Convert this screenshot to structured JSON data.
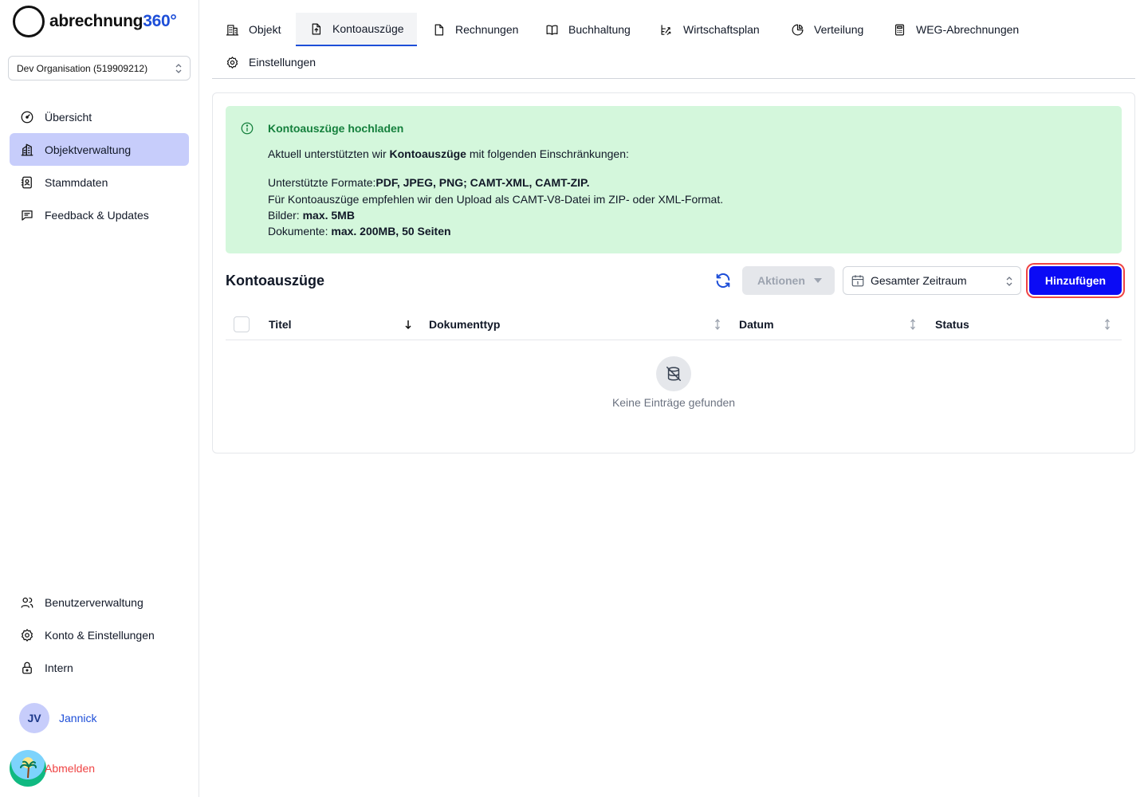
{
  "brand": {
    "name_main": "abrechnung",
    "name_accent": "360°"
  },
  "organization": {
    "selected": "Dev Organisation (519909212)"
  },
  "sidebar": {
    "top_items": [
      {
        "label": "Übersicht",
        "icon": "gauge-icon"
      },
      {
        "label": "Objektverwaltung",
        "icon": "buildings-icon",
        "active": true
      },
      {
        "label": "Stammdaten",
        "icon": "address-book-icon"
      },
      {
        "label": "Feedback & Updates",
        "icon": "chat-icon"
      }
    ],
    "bottom_items": [
      {
        "label": "Benutzerverwaltung",
        "icon": "users-icon"
      },
      {
        "label": "Konto & Einstellungen",
        "icon": "gear-icon"
      },
      {
        "label": "Intern",
        "icon": "lock-icon"
      }
    ],
    "user": {
      "initials": "JV",
      "name": "Jannick"
    },
    "logout_label": "Abmelden"
  },
  "tabs": [
    {
      "label": "Objekt",
      "icon": "building-icon"
    },
    {
      "label": "Kontoauszüge",
      "icon": "file-upload-icon",
      "active": true
    },
    {
      "label": "Rechnungen",
      "icon": "file-icon"
    },
    {
      "label": "Buchhaltung",
      "icon": "book-icon"
    },
    {
      "label": "Wirtschaftsplan",
      "icon": "chart-arrow-icon"
    },
    {
      "label": "Verteilung",
      "icon": "pie-chart-icon"
    },
    {
      "label": "WEG-Abrechnungen",
      "icon": "calculator-icon"
    },
    {
      "label": "Einstellungen",
      "icon": "gear-icon"
    }
  ],
  "alert": {
    "title": "Kontoauszüge hochladen",
    "intro_prefix": "Aktuell unterstützten wir ",
    "intro_bold": "Kontoauszüge",
    "intro_suffix": " mit folgenden Einschränkungen:",
    "formats_prefix": "Unterstützte Formate:",
    "formats_bold": "PDF, JPEG, PNG; CAMT-XML, CAMT-ZIP.",
    "recommendation": "Für Kontoauszüge empfehlen wir den Upload als CAMT-V8-Datei im ZIP- oder XML-Format.",
    "images_prefix": "Bilder: ",
    "images_bold": "max. 5MB",
    "documents_prefix": "Dokumente: ",
    "documents_bold": "max. 200MB, 50 Seiten"
  },
  "list": {
    "title": "Kontoauszüge",
    "actions_label": "Aktionen",
    "range_label": "Gesamter Zeitraum",
    "add_label": "Hinzufügen",
    "columns": [
      "Titel",
      "Dokumenttyp",
      "Datum",
      "Status"
    ],
    "empty_text": "Keine Einträge gefunden"
  }
}
